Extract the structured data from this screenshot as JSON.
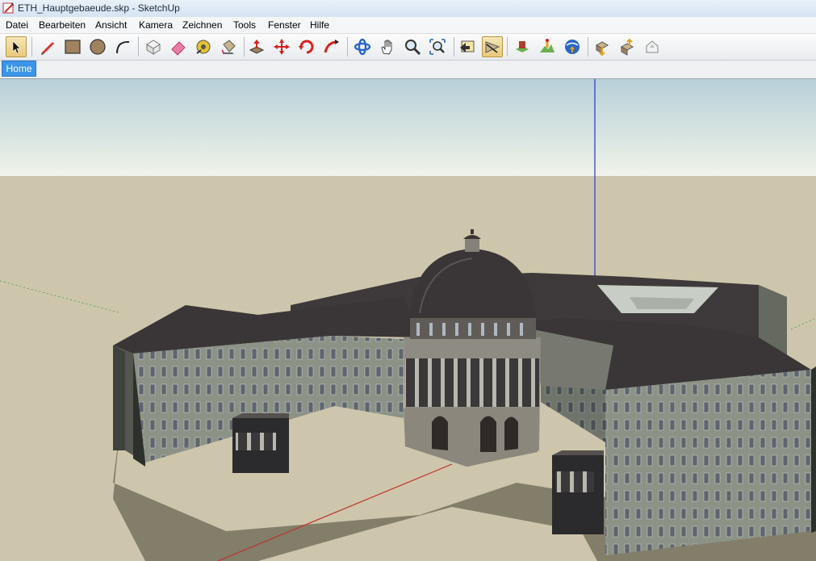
{
  "window": {
    "title": "ETH_Hauptgebaeude.skp - SketchUp"
  },
  "menu": {
    "items": [
      "Datei",
      "Bearbeiten",
      "Ansicht",
      "Kamera",
      "Zeichnen",
      "Tools",
      "Fenster",
      "Hilfe"
    ]
  },
  "toolbar": {
    "tools": [
      {
        "name": "select-icon",
        "active": true
      },
      {
        "name": "pencil-icon"
      },
      {
        "name": "rectangle-icon"
      },
      {
        "name": "circle-icon"
      },
      {
        "name": "arc-icon"
      },
      {
        "name": "make-component-icon"
      },
      {
        "name": "eraser-icon"
      },
      {
        "name": "tape-measure-icon"
      },
      {
        "name": "paint-bucket-icon"
      },
      {
        "name": "push-pull-icon"
      },
      {
        "name": "move-icon"
      },
      {
        "name": "rotate-icon"
      },
      {
        "name": "follow-me-icon"
      },
      {
        "name": "orbit-icon"
      },
      {
        "name": "pan-icon"
      },
      {
        "name": "zoom-icon"
      },
      {
        "name": "zoom-extents-icon"
      },
      {
        "name": "previous-view-icon"
      },
      {
        "name": "next-view-icon"
      },
      {
        "name": "add-location-icon"
      },
      {
        "name": "toggle-terrain-icon"
      },
      {
        "name": "get-models-icon"
      },
      {
        "name": "share-model-icon"
      },
      {
        "name": "share-component-icon"
      },
      {
        "name": "send-to-earth-icon"
      }
    ]
  },
  "tabs": {
    "scene_tab": "Home"
  },
  "colors": {
    "sky_top": "#b7d0d8",
    "sky_bottom": "#f1f3e9",
    "ground": "#cdc6ac",
    "roof": "#3e3a3b",
    "facade": "#8f9487",
    "blue_axis": "#2236c8",
    "red_axis": "#c0302a",
    "green_axis": "#4c9a4c"
  }
}
